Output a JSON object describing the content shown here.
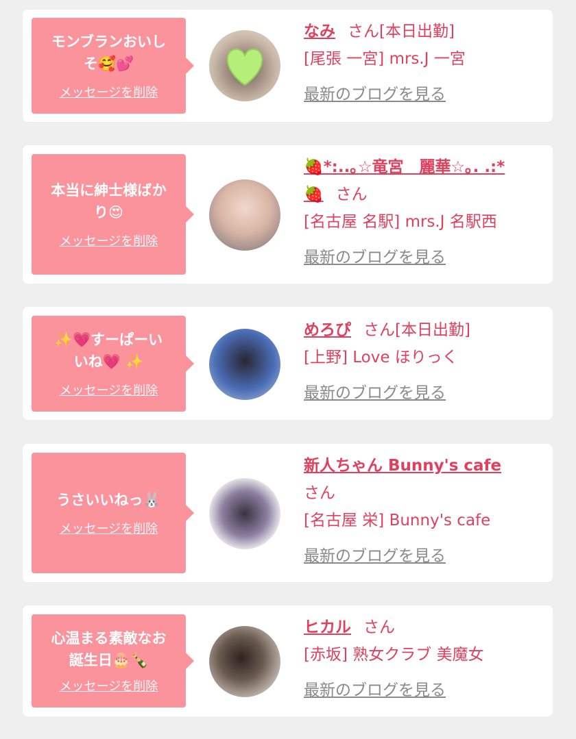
{
  "colors": {
    "bubble": "#fb939c",
    "accent": "#e0405d",
    "link_gray": "#8a8a8a",
    "background": "#efefef"
  },
  "delete_label": "メッセージを削除",
  "blog_label": "最新のブログを見る",
  "san": "さん",
  "cards": [
    {
      "msg1": "モンブランおいし",
      "msg2": "そ🥰💕",
      "name": "なみ",
      "status": "[本日出勤]",
      "location": "[尾張 一宮] mrs.J 一宮"
    },
    {
      "msg1": "本当に紳士様ばか",
      "msg2": "り😍",
      "name": "🍓*:..｡☆竜宮　麗華☆｡. .:*",
      "name2": "🍓",
      "status": "",
      "location": "[名古屋 名駅] mrs.J 名駅西"
    },
    {
      "msg1": "✨💗すーぱーい",
      "msg2": "いね💗 ✨",
      "name": "めろぴ",
      "status": "[本日出勤]",
      "location": "[上野] Love ほりっく"
    },
    {
      "msg1": "うさいいねっ🐰",
      "msg2": "",
      "name": "新人ちゃん Bunny's cafe",
      "status": "",
      "location": "[名古屋 栄] Bunny's cafe"
    },
    {
      "msg1": "心温まる素敵なお",
      "msg2": "誕生日🎂🍾",
      "name": "ヒカル",
      "status": "",
      "location": "[赤坂] 熟女クラブ 美魔女"
    }
  ]
}
